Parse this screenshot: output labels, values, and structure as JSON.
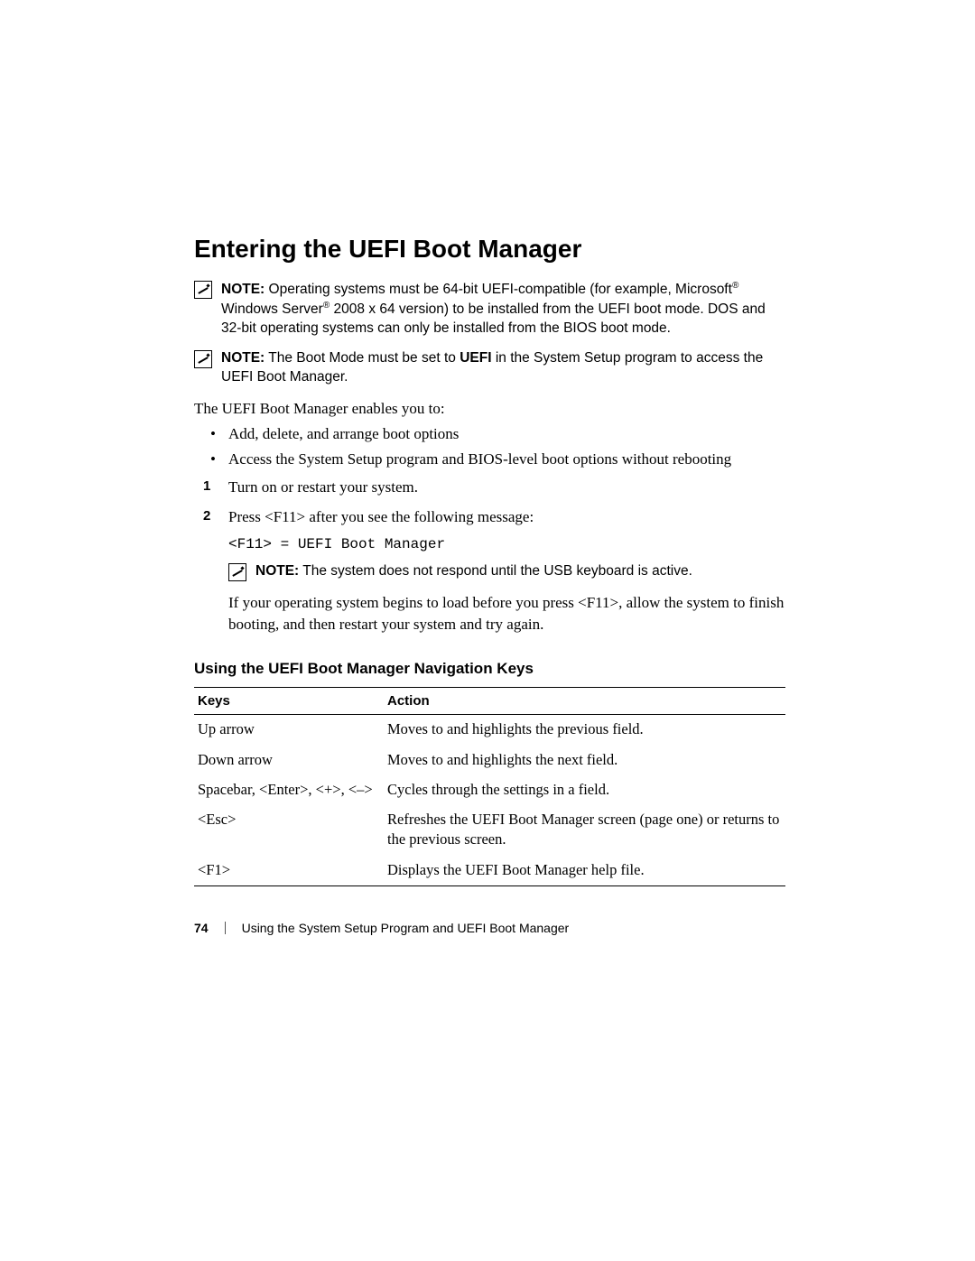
{
  "heading": "Entering the UEFI Boot Manager",
  "notes": {
    "note_label": "NOTE:",
    "n1_a": " Operating systems must be 64-bit UEFI-compatible (for example, Microsoft",
    "n1_b": " Windows Server",
    "n1_c": " 2008 x 64 version) to be installed from the UEFI boot mode. DOS and 32-bit operating systems can only be installed from the BIOS boot mode.",
    "n2_a": " The Boot Mode must be set to ",
    "n2_uefi": "UEFI",
    "n2_b": " in the System Setup program to access the UEFI Boot Manager.",
    "n3": " The system does not respond until the USB keyboard is active."
  },
  "intro": "The UEFI Boot Manager enables you to:",
  "bullets": [
    "Add, delete, and arrange boot options",
    "Access the System Setup program and BIOS-level boot options without rebooting"
  ],
  "steps": {
    "s1": "Turn on or restart your system.",
    "s2": "Press <F11> after you see the following message:",
    "s2_code": "<F11> = UEFI Boot Manager",
    "s2_after": "If your operating system begins to load before you press <F11>, allow the system to finish booting, and then restart your system and try again."
  },
  "subheading": "Using the UEFI Boot Manager Navigation Keys",
  "table": {
    "head_keys": "Keys",
    "head_action": "Action",
    "rows": [
      {
        "k": "Up arrow",
        "a": "Moves to and highlights the previous field."
      },
      {
        "k": "Down arrow",
        "a": "Moves to and highlights the next field."
      },
      {
        "k": "Spacebar, <Enter>, <+>, <–>",
        "a": "Cycles through the settings in a field."
      },
      {
        "k": "<Esc>",
        "a": "Refreshes the UEFI Boot Manager screen (page one) or returns to the previous screen."
      },
      {
        "k": "<F1>",
        "a": "Displays the UEFI Boot Manager help file."
      }
    ]
  },
  "footer": {
    "page": "74",
    "title": "Using the System Setup Program and UEFI Boot Manager"
  }
}
